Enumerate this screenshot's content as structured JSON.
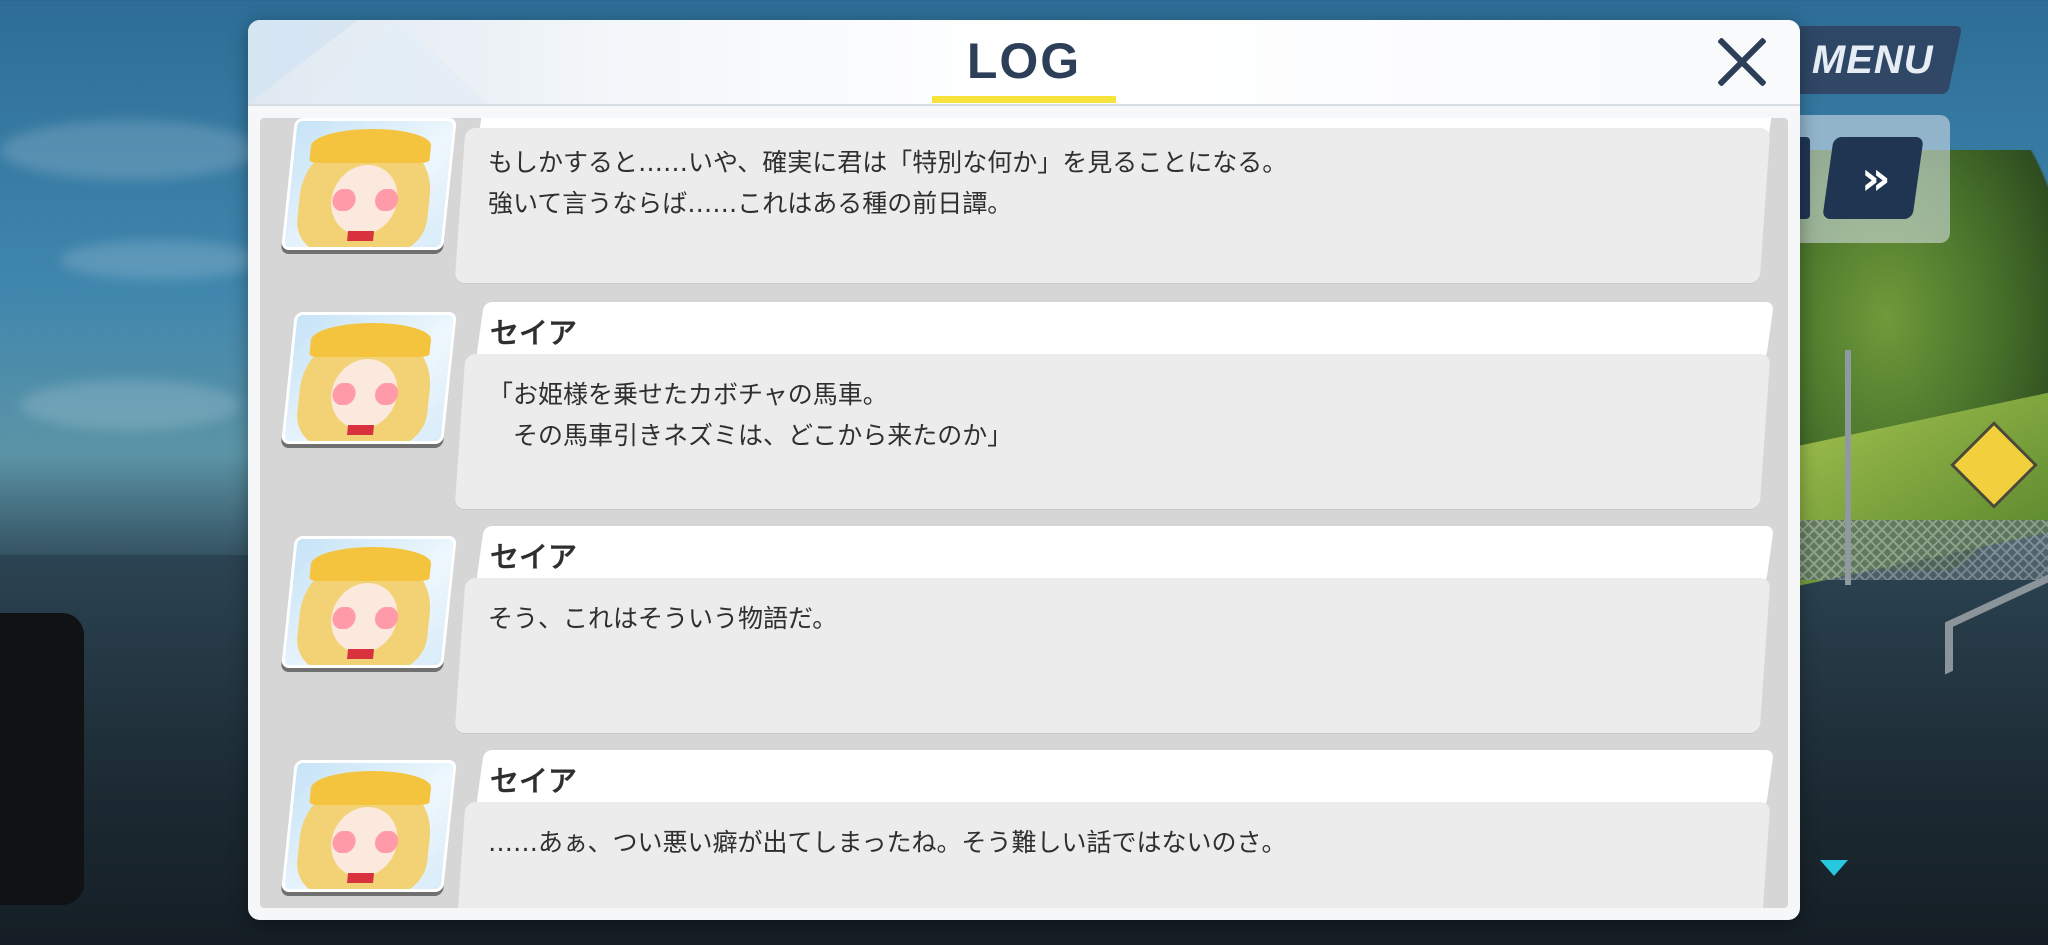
{
  "hud": {
    "menu_label": "MENU",
    "skip_label": "»"
  },
  "log": {
    "title": "LOG",
    "entries": [
      {
        "speaker": "",
        "text": "もしかすると……いや、確実に君は「特別な何か」を見ることになる。\n強いて言うならば……これはある種の前日譚。"
      },
      {
        "speaker": "セイア",
        "text": "「お姫様を乗せたカボチャの馬車。\n　その馬車引きネズミは、どこから来たのか」"
      },
      {
        "speaker": "セイア",
        "text": "そう、これはそういう物語だ。"
      },
      {
        "speaker": "セイア",
        "text": "……あぁ、つい悪い癖が出てしまったね。そう難しい話ではないのさ。"
      }
    ]
  },
  "colors": {
    "accent_underline": "#f7e33c",
    "title_color": "#2c3e58",
    "scroll_indicator": "#27c7e0"
  },
  "icons": {
    "close": "close-icon",
    "skip": "fast-forward-icon",
    "scroll": "triangle-down-icon"
  }
}
